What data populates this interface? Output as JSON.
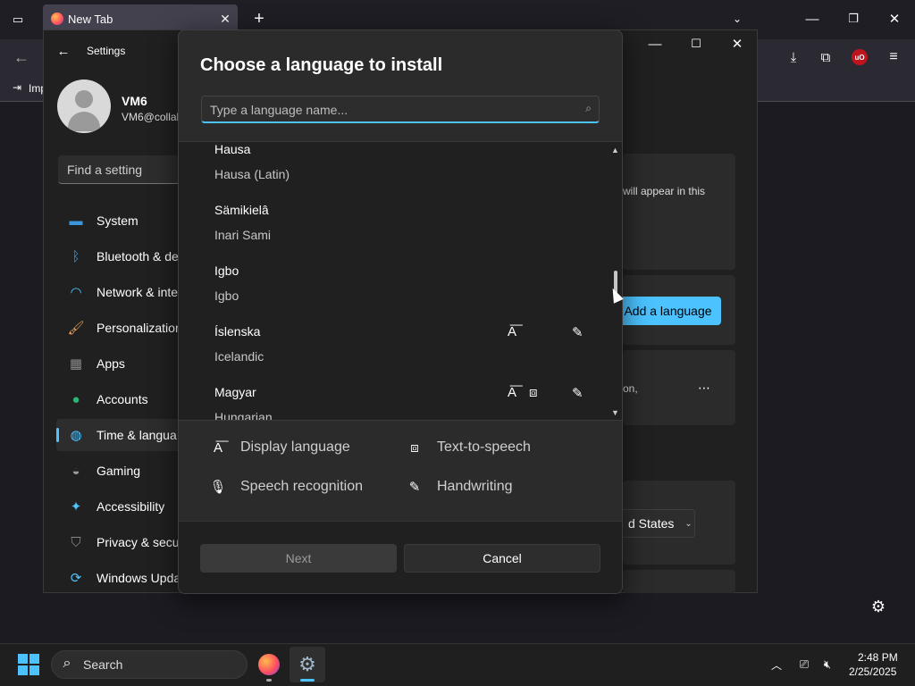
{
  "browser": {
    "tab_title": "New Tab",
    "bookmark_label": "Imp"
  },
  "settings": {
    "title": "Settings",
    "user_name": "VM6",
    "user_email": "VM6@collab",
    "find_placeholder": "Find a setting",
    "nav": [
      {
        "label": "System",
        "icon": "monitor-icon",
        "color": "#3a96dd"
      },
      {
        "label": "Bluetooth & de",
        "icon": "bluetooth-icon",
        "color": "#3a96dd"
      },
      {
        "label": "Network & inte",
        "icon": "wifi-icon",
        "color": "#4cc2ff"
      },
      {
        "label": "Personalization",
        "icon": "brush-icon",
        "color": "#e8a25c"
      },
      {
        "label": "Apps",
        "icon": "apps-icon",
        "color": "#8a8a8a"
      },
      {
        "label": "Accounts",
        "icon": "person-icon",
        "color": "#2bb673"
      },
      {
        "label": "Time & langua",
        "icon": "globe-clock-icon",
        "color": "#4cc2ff"
      },
      {
        "label": "Gaming",
        "icon": "gamepad-icon",
        "color": "#9a9a9a"
      },
      {
        "label": "Accessibility",
        "icon": "accessibility-icon",
        "color": "#4cc2ff"
      },
      {
        "label": "Privacy & secu",
        "icon": "shield-icon",
        "color": "#8a8a8a"
      },
      {
        "label": "Windows Upda",
        "icon": "update-icon",
        "color": "#4cc2ff"
      }
    ],
    "right_text_1": "will appear in this",
    "add_language": "Add a language",
    "right_text_2": "on,",
    "region_value": "d States"
  },
  "dialog": {
    "title": "Choose a language to install",
    "search_placeholder": "Type a language name...",
    "languages": [
      {
        "native": "Hausa",
        "english": "Hausa (Latin)",
        "display": false,
        "tts": false,
        "handwriting": false
      },
      {
        "native": "Sämikielâ",
        "english": "Inari Sami",
        "display": false,
        "tts": false,
        "handwriting": false
      },
      {
        "native": "Igbo",
        "english": "Igbo",
        "display": false,
        "tts": false,
        "handwriting": false
      },
      {
        "native": "Íslenska",
        "english": "Icelandic",
        "display": true,
        "tts": false,
        "handwriting": true
      },
      {
        "native": "Magyar",
        "english": "Hungarian",
        "display": true,
        "tts": true,
        "handwriting": true
      }
    ],
    "legend": {
      "display": "Display language",
      "tts": "Text-to-speech",
      "speech": "Speech recognition",
      "handwriting": "Handwriting"
    },
    "next": "Next",
    "cancel": "Cancel"
  },
  "taskbar": {
    "search": "Search",
    "time": "2:48 PM",
    "date": "2/25/2025"
  }
}
